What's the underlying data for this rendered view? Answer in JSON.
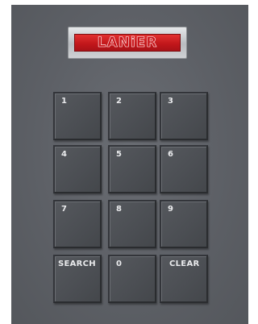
{
  "brand": {
    "logo_text": "LANiER"
  },
  "keypad": {
    "keys": [
      {
        "label": "1"
      },
      {
        "label": "2"
      },
      {
        "label": "3"
      },
      {
        "label": "4"
      },
      {
        "label": "5"
      },
      {
        "label": "6"
      },
      {
        "label": "7"
      },
      {
        "label": "8"
      },
      {
        "label": "9"
      },
      {
        "label": "SEARCH"
      },
      {
        "label": "0"
      },
      {
        "label": "CLEAR"
      }
    ]
  },
  "colors": {
    "panel": "#5d6066",
    "logo_red": "#c0161a",
    "key_face": "#4b4e53",
    "key_text": "#e9eaec"
  }
}
